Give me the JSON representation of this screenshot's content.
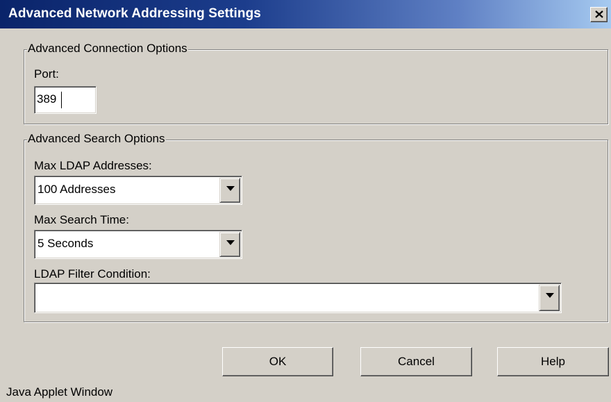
{
  "window": {
    "title": "Advanced Network Addressing Settings",
    "close_icon": "close-icon"
  },
  "connection_group": {
    "legend": "Advanced Connection Options",
    "port_label": "Port:",
    "port_value": "389"
  },
  "search_group": {
    "legend": "Advanced Search Options",
    "max_addresses_label": "Max LDAP Addresses:",
    "max_addresses_value": "100 Addresses",
    "max_time_label": "Max Search Time:",
    "max_time_value": "5 Seconds",
    "filter_label": "LDAP Filter Condition:",
    "filter_value": ""
  },
  "buttons": {
    "ok": "OK",
    "cancel": "Cancel",
    "help": "Help"
  },
  "status_text": "Java Applet Window",
  "colors": {
    "titlebar_start": "#0a246a",
    "titlebar_end": "#a6caf0",
    "face": "#d4d0c8"
  }
}
